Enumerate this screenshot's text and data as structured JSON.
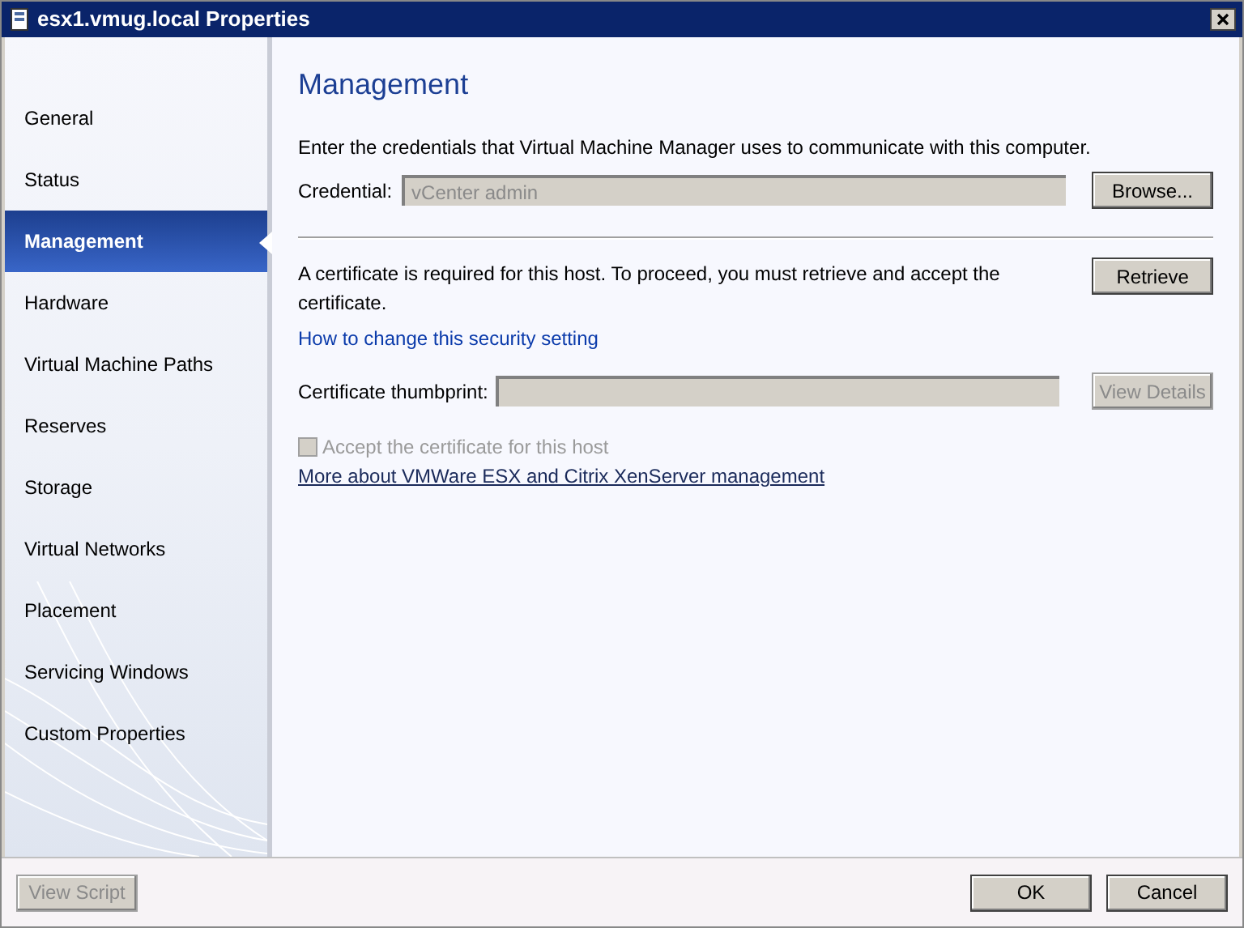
{
  "window": {
    "title": "esx1.vmug.local Properties"
  },
  "sidebar": {
    "items": [
      {
        "label": "General",
        "selected": false
      },
      {
        "label": "Status",
        "selected": false
      },
      {
        "label": "Management",
        "selected": true
      },
      {
        "label": "Hardware",
        "selected": false
      },
      {
        "label": "Virtual Machine Paths",
        "selected": false
      },
      {
        "label": "Reserves",
        "selected": false
      },
      {
        "label": "Storage",
        "selected": false
      },
      {
        "label": "Virtual Networks",
        "selected": false
      },
      {
        "label": "Placement",
        "selected": false
      },
      {
        "label": "Servicing Windows",
        "selected": false
      },
      {
        "label": "Custom Properties",
        "selected": false
      }
    ]
  },
  "page": {
    "heading": "Management",
    "intro": "Enter the credentials that Virtual Machine Manager uses to communicate with this computer.",
    "credential": {
      "label": "Credential:",
      "value": "vCenter admin",
      "disabled": true
    },
    "browse_button": {
      "label": "Browse...",
      "disabled": false
    },
    "certificate_note": "A certificate is required for this host. To proceed, you must retrieve and accept the certificate.",
    "retrieve_button": {
      "label": "Retrieve",
      "disabled": false
    },
    "security_link": "How to change this security setting",
    "thumbprint": {
      "label": "Certificate thumbprint:",
      "disabled": true
    },
    "view_details_button": {
      "label": "View Details",
      "disabled": true
    },
    "accept_checkbox": {
      "label": "Accept the certificate for this host",
      "checked": false,
      "disabled": true
    },
    "more_link": "More about VMWare ESX and Citrix XenServer management"
  },
  "footer": {
    "buttons": [
      {
        "label": "View Script",
        "disabled": true
      },
      {
        "label": "OK",
        "disabled": false
      },
      {
        "label": "Cancel",
        "disabled": false
      }
    ]
  }
}
